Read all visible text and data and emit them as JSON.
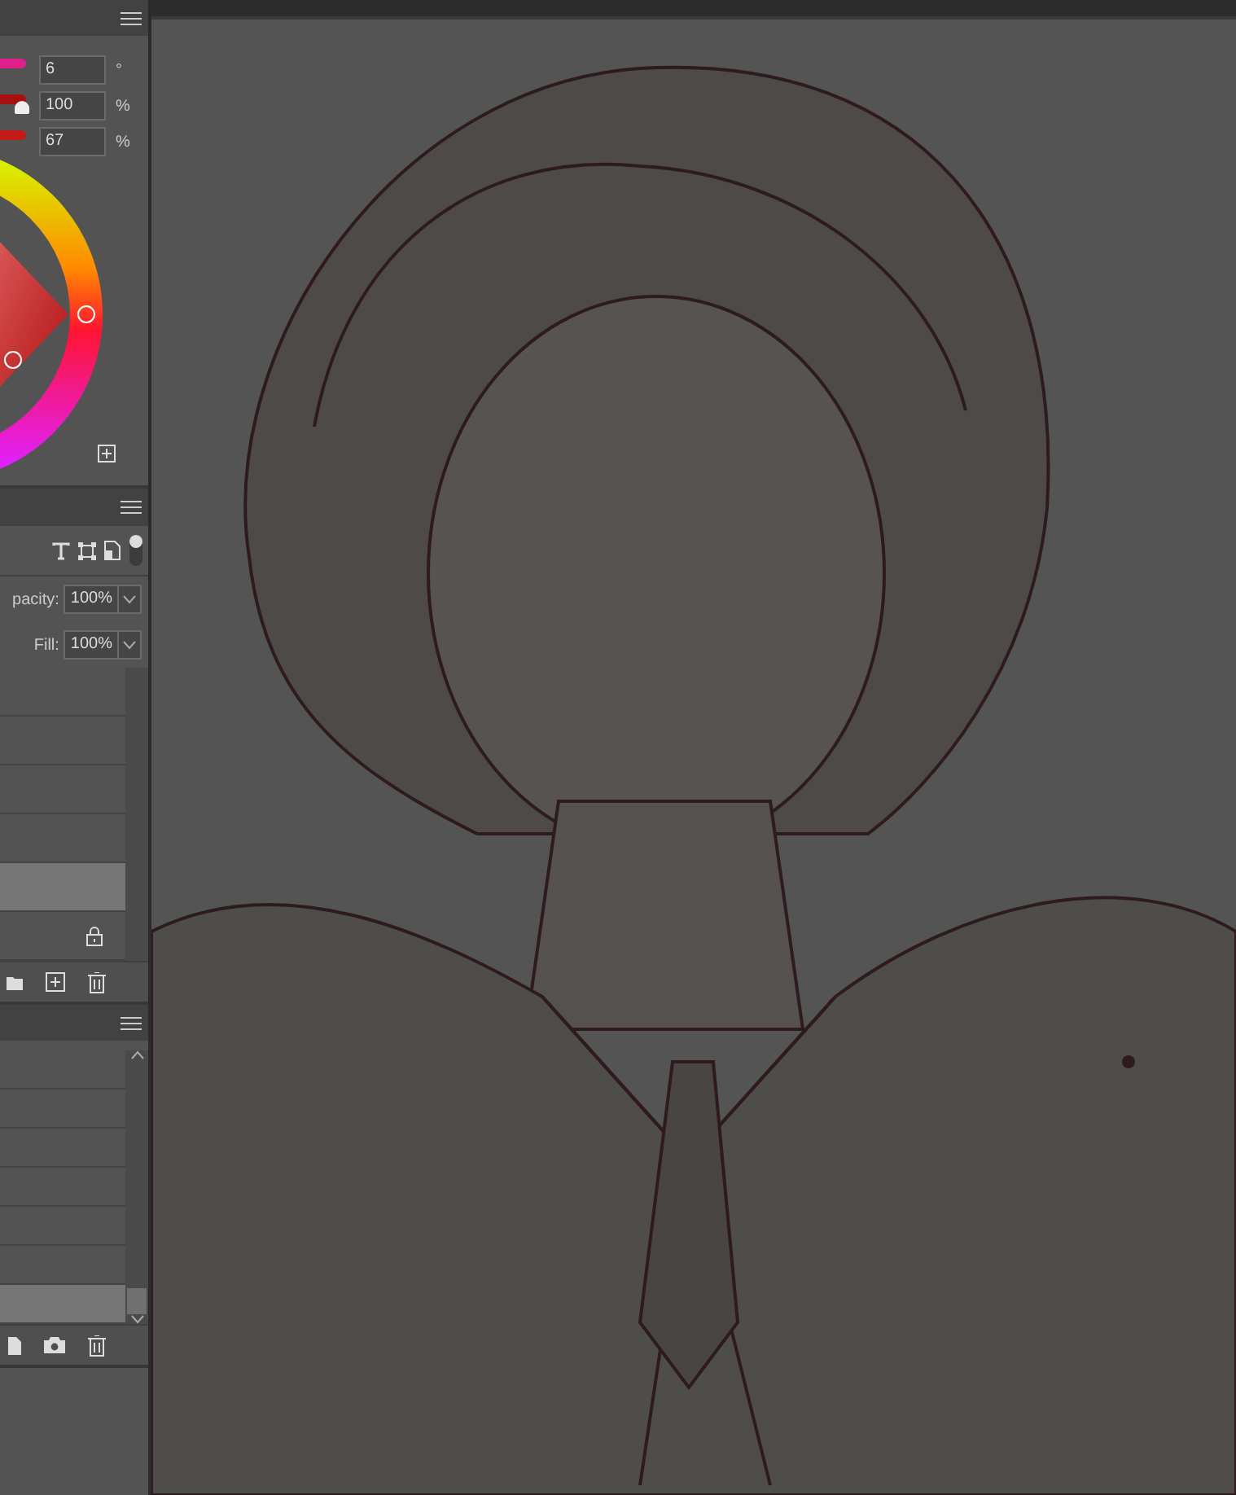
{
  "color_panel": {
    "fields": [
      {
        "value": "6",
        "unit": "°",
        "level": 0.02
      },
      {
        "value": "100",
        "unit": "%",
        "level": 1
      },
      {
        "value": "67",
        "unit": "%",
        "level": 0.67
      }
    ]
  },
  "layers_panel": {
    "opacity": {
      "label": "pacity:",
      "value": "100%"
    },
    "fill": {
      "label": "Fill:",
      "value": "100%"
    },
    "rows": [
      {
        "selected": false,
        "locked": false
      },
      {
        "selected": false,
        "locked": false
      },
      {
        "selected": false,
        "locked": false
      },
      {
        "selected": false,
        "locked": false
      },
      {
        "selected": true,
        "locked": false
      },
      {
        "selected": false,
        "locked": true
      }
    ]
  },
  "history_panel": {
    "rows": [
      {
        "selected": false
      },
      {
        "selected": false
      },
      {
        "selected": false
      },
      {
        "selected": false
      },
      {
        "selected": false
      },
      {
        "selected": false
      },
      {
        "selected": true
      }
    ]
  }
}
